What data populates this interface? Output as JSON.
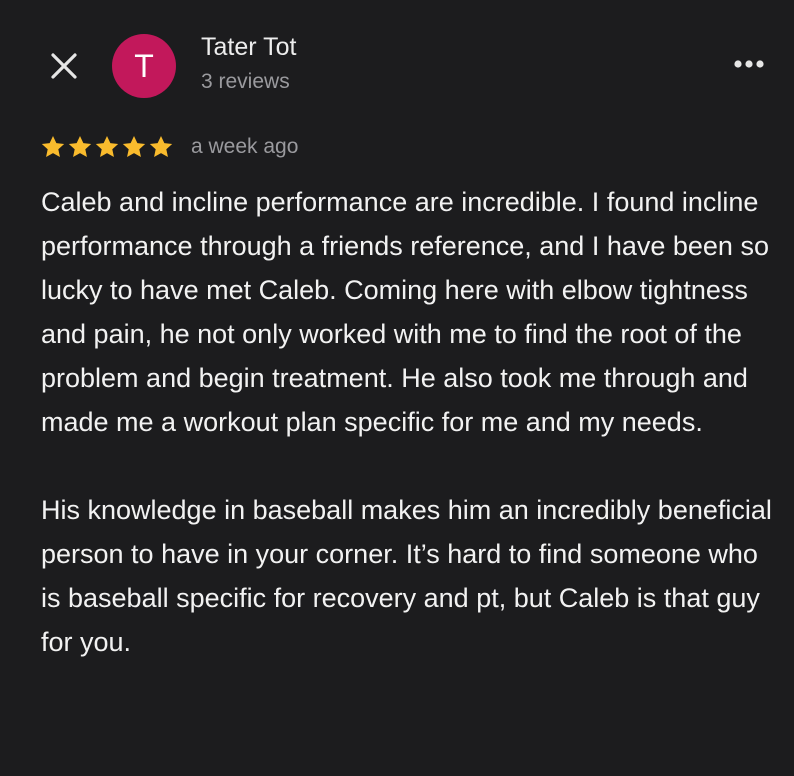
{
  "header": {
    "close_icon": "close-icon",
    "more_icon": "more-options-icon"
  },
  "reviewer": {
    "avatar_letter": "T",
    "avatar_color": "#c2185b",
    "name": "Tater Tot",
    "review_count": "3 reviews"
  },
  "review": {
    "rating": 5,
    "rating_max": 5,
    "star_color": "#f9bb2d",
    "timestamp": "a week ago",
    "paragraphs": [
      "Caleb and incline performance are incredible. I found incline performance through a friends reference, and I have been so lucky to have met Caleb. Coming here with elbow tightness and pain, he not only worked with me to find the root of the problem and begin treatment. He also took me through and made me a workout plan specific for me and my needs.",
      "His knowledge in baseball makes him an incredibly beneficial person to have in your corner. It’s hard to find someone who is baseball specific for recovery and pt, but Caleb is that guy for you."
    ]
  },
  "colors": {
    "background": "#1c1c1e",
    "text_primary": "#f2f2f2",
    "text_secondary": "#9a9a9e"
  }
}
